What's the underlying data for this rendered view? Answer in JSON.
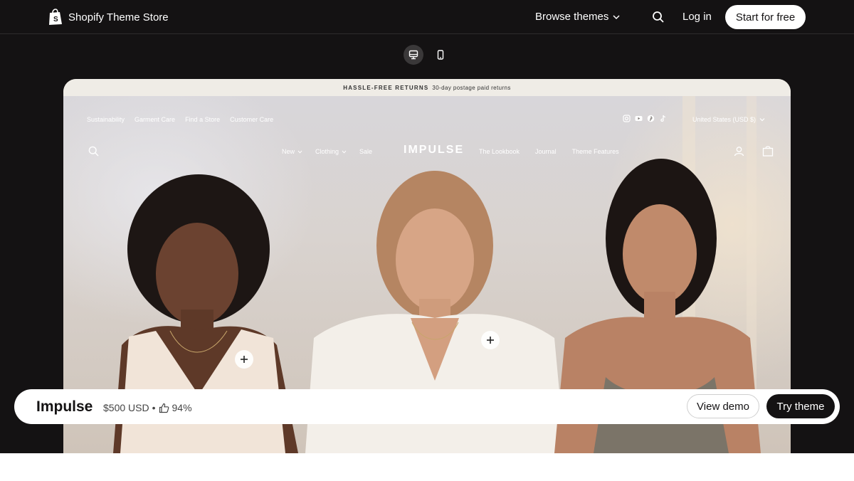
{
  "header": {
    "brand": "Shopify Theme Store",
    "browse_label": "Browse themes",
    "login_label": "Log in",
    "start_label": "Start for free",
    "icons": [
      "shopify-bag-icon",
      "chevron-down-icon",
      "search-icon"
    ]
  },
  "device_toggle": {
    "options": [
      "desktop",
      "mobile"
    ],
    "selected": "desktop"
  },
  "preview": {
    "announcement": {
      "bold": "HASSLE-FREE RETURNS",
      "text": "30-day postage paid returns"
    },
    "utility_links": [
      "Sustainability",
      "Garment Care",
      "Find a Store",
      "Customer Care"
    ],
    "socials": [
      "instagram-icon",
      "youtube-icon",
      "pinterest-icon",
      "tiktok-icon"
    ],
    "currency": "United States (USD $)",
    "nav_left": [
      {
        "label": "New",
        "has_dropdown": true
      },
      {
        "label": "Clothing",
        "has_dropdown": true
      },
      {
        "label": "Sale",
        "has_dropdown": false
      }
    ],
    "logo": "IMPULSE",
    "nav_right": [
      "The Lookbook",
      "Journal",
      "Theme Features"
    ]
  },
  "theme_bar": {
    "name": "Impulse",
    "price": "$500 USD",
    "separator": "•",
    "rating": "94%",
    "view_demo_label": "View demo",
    "try_label": "Try theme"
  },
  "colors": {
    "background_dark": "#141213",
    "button_light": "#ffffff",
    "button_dark": "#141213"
  }
}
